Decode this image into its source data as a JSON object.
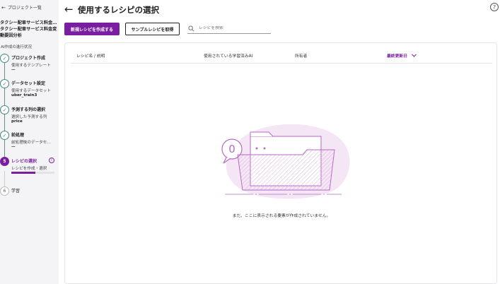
{
  "sidebar": {
    "back_label": "プロジェクト一覧",
    "project_title_1": "タクシー配車サービス料金…",
    "project_title_2": "タクシー配車サービス料金変",
    "project_title_3": "動要因分析",
    "section_label": "AI作成の進行状況",
    "steps": [
      {
        "title": "プロジェクト作成",
        "sub": "使用するテンプレート",
        "value": "—"
      },
      {
        "title": "データセット設定",
        "sub": "使用するデータセット",
        "value": "uber_train3"
      },
      {
        "title": "予測する列の選択",
        "sub": "選択した予測する列",
        "value": "price"
      },
      {
        "title": "前処理",
        "sub": "前処理後のデータセ…",
        "value": "—"
      },
      {
        "number": "5",
        "title": "レシピの選択",
        "sub": "レシピを作成・選択",
        "progress": 0.55
      },
      {
        "number": "6",
        "title": "学習"
      }
    ]
  },
  "header": {
    "title": "使用するレシピの選択"
  },
  "toolbar": {
    "new_recipe_label": "新規レシピを作成する",
    "sample_recipe_label": "サンプルレシピを取得",
    "search_placeholder": "レシピを検索"
  },
  "table": {
    "columns": [
      "レシピ名 / 説明",
      "使用されている学習済みAI",
      "所有者",
      "最終更新日"
    ],
    "empty_message": "まだ、ここに表示される要素が作成されていません。"
  },
  "illustration": {
    "bubble_text": "0"
  },
  "colors": {
    "accent": "#7a1ea1",
    "step_done": "#3d8a7e",
    "illustration_bg": "#f4e6f5"
  }
}
